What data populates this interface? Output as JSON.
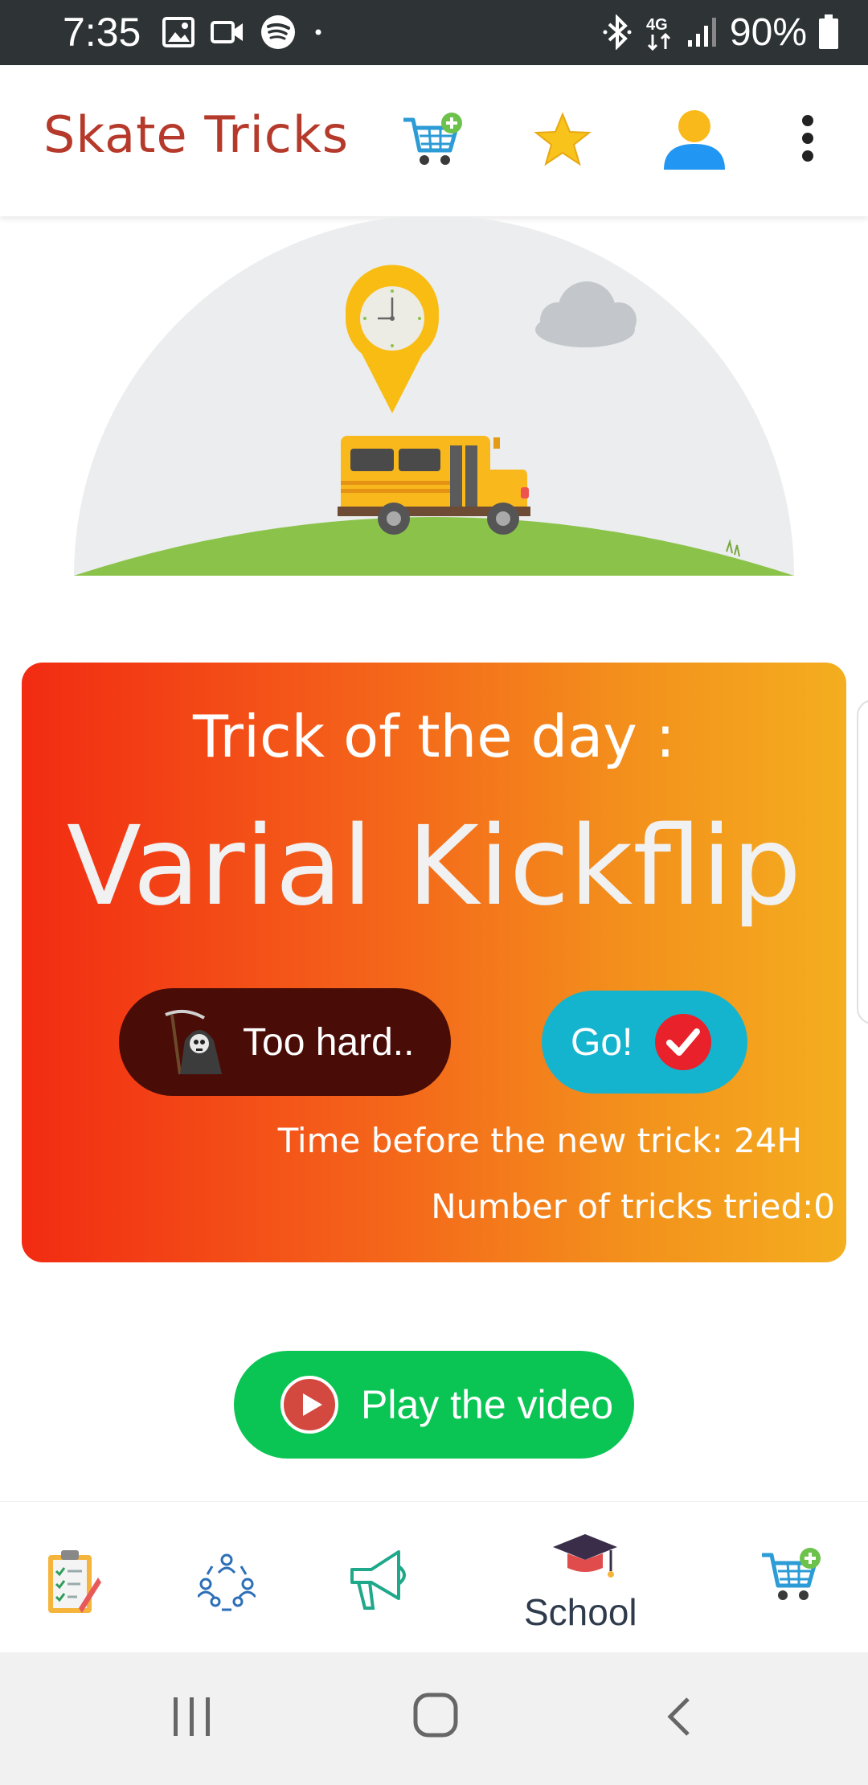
{
  "status_bar": {
    "time": "7:35",
    "battery": "90%",
    "left_icons": [
      "image-icon",
      "video-icon",
      "spotify-icon",
      "dot-icon"
    ],
    "right_icons": [
      "bluetooth-icon",
      "4g-icon",
      "signal-icon",
      "battery-icon"
    ]
  },
  "app_bar": {
    "title": "Skate Tricks",
    "icons": [
      "cart-add-icon",
      "star-icon",
      "user-icon",
      "more-vert-icon"
    ]
  },
  "card": {
    "heading": "Trick of the day :",
    "trick_name": "Varial Kickflip",
    "too_hard_label": "Too hard..",
    "go_label": "Go!",
    "timer_text": "Time before the new trick:  24H",
    "tried_text": "Number of tricks tried:0"
  },
  "play_button": {
    "label": "Play the video"
  },
  "bottom_nav": {
    "items": [
      "checklist-icon",
      "community-icon",
      "megaphone-icon",
      "graduation-cap-icon",
      "cart-add-icon"
    ],
    "active_label": "School"
  },
  "colors": {
    "status_bar": "#2e3336",
    "title": "#b53a2b",
    "card_start": "#f22b12",
    "card_end": "#f4ae1f",
    "too_hard": "#4a0c06",
    "go": "#14b4cf",
    "play": "#0ac553"
  }
}
